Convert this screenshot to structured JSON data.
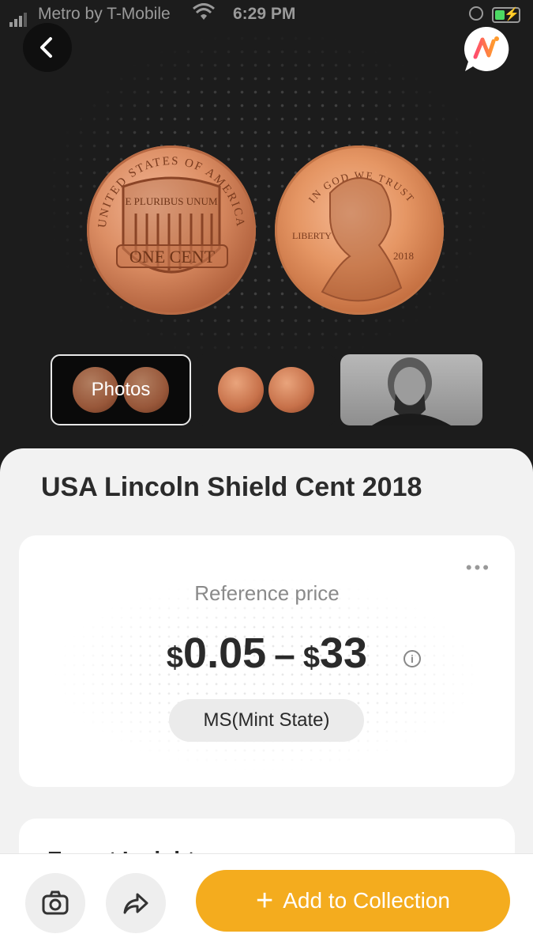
{
  "status_bar": {
    "carrier": "Metro by T-Mobile",
    "time": "6:29 PM"
  },
  "hero": {
    "thumbnails": [
      {
        "label": "Photos",
        "selected": true
      },
      {
        "label": "",
        "selected": false
      },
      {
        "label": "",
        "selected": false
      }
    ]
  },
  "coin": {
    "title": "USA Lincoln Shield Cent 2018",
    "back_text": {
      "top": "UNITED STATES OF AMERICA",
      "motto": "E PLURIBUS UNUM",
      "value": "ONE CENT"
    },
    "front_text": {
      "motto": "IN GOD WE TRUST",
      "liberty": "LIBERTY",
      "year": "2018"
    }
  },
  "price_card": {
    "label": "Reference price",
    "currency": "$",
    "low": "0.05",
    "separator": "–",
    "high": "33",
    "grade": "MS(Mint State)",
    "info_glyph": "i",
    "more_glyph": "•••"
  },
  "insights": {
    "title": "Expert Insights"
  },
  "bottom_bar": {
    "add_button_label": "Add to Collection",
    "add_button_icon": "+"
  },
  "colors": {
    "accent": "#f4ac1e",
    "battery": "#4cd964",
    "logo_gradient": [
      "#ff4d6d",
      "#ff9a2e"
    ]
  },
  "icons": [
    "back-arrow-icon",
    "app-logo-icon",
    "info-icon",
    "more-icon",
    "camera-icon",
    "share-icon",
    "plus-icon",
    "wifi-icon",
    "signal-icon",
    "battery-icon"
  ]
}
